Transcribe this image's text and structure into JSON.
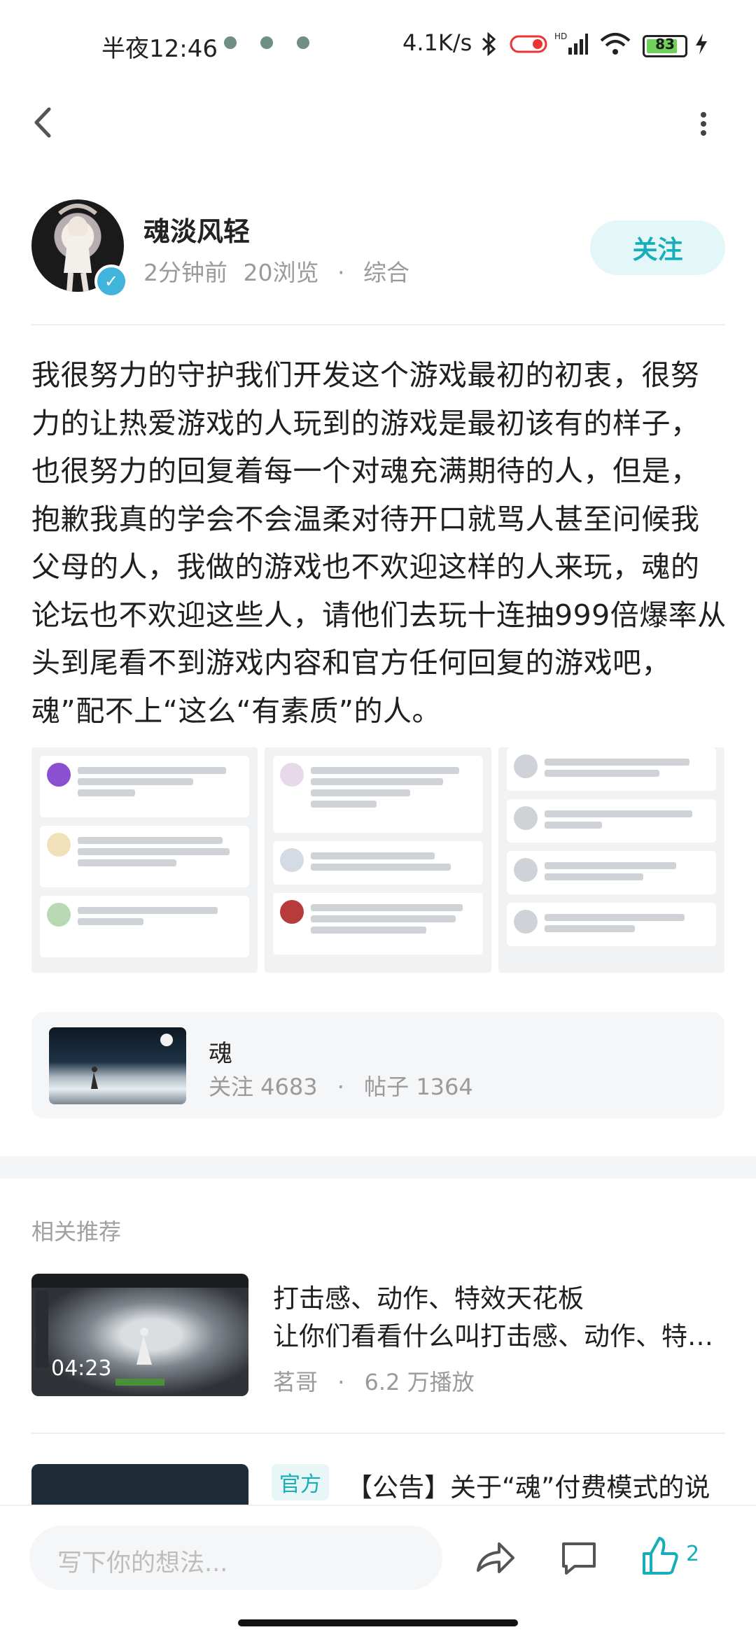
{
  "status_bar": {
    "time": "半夜12:46",
    "net_speed": "4.1K/s",
    "battery": "83"
  },
  "post": {
    "author": "魂淡风轻",
    "time_ago": "2分钟前",
    "views": "20浏览",
    "category": "综合",
    "follow_label": "关注",
    "content": "我很努力的守护我们开发这个游戏最初的初衷，很努力的让热爱游戏的人玩到的游戏是最初该有的样子，也很努力的回复着每一个对魂充满期待的人，但是，抱歉我真的学会不会温柔对待开口就骂人甚至问候我父母的人，我做的游戏也不欢迎这样的人来玩，魂的论坛也不欢迎这些人，请他们去玩十连抽999倍爆率从头到尾看不到游戏内容和官方任何回复的游戏吧，魂”配不上“这么“有素质”的人。"
  },
  "topic": {
    "name": "魂",
    "followers": "关注 4683",
    "posts": "帖子 1364"
  },
  "recommend": {
    "section_title": "相关推荐",
    "items": [
      {
        "title": "打击感、动作、特效天花板",
        "subtitle": "让你们看看什么叫打击感、动作、特效天花板",
        "duration": "04:23",
        "author": "茗哥",
        "plays": "6.2 万播放"
      },
      {
        "badge": "官方",
        "title": "【公告】关于“魂”付费模式的说"
      }
    ]
  },
  "bottom_bar": {
    "input_placeholder": "写下你的想法...",
    "like_count": "2"
  },
  "colors": {
    "accent": "#17aeb9",
    "follow_bg": "#e4f7f8"
  }
}
